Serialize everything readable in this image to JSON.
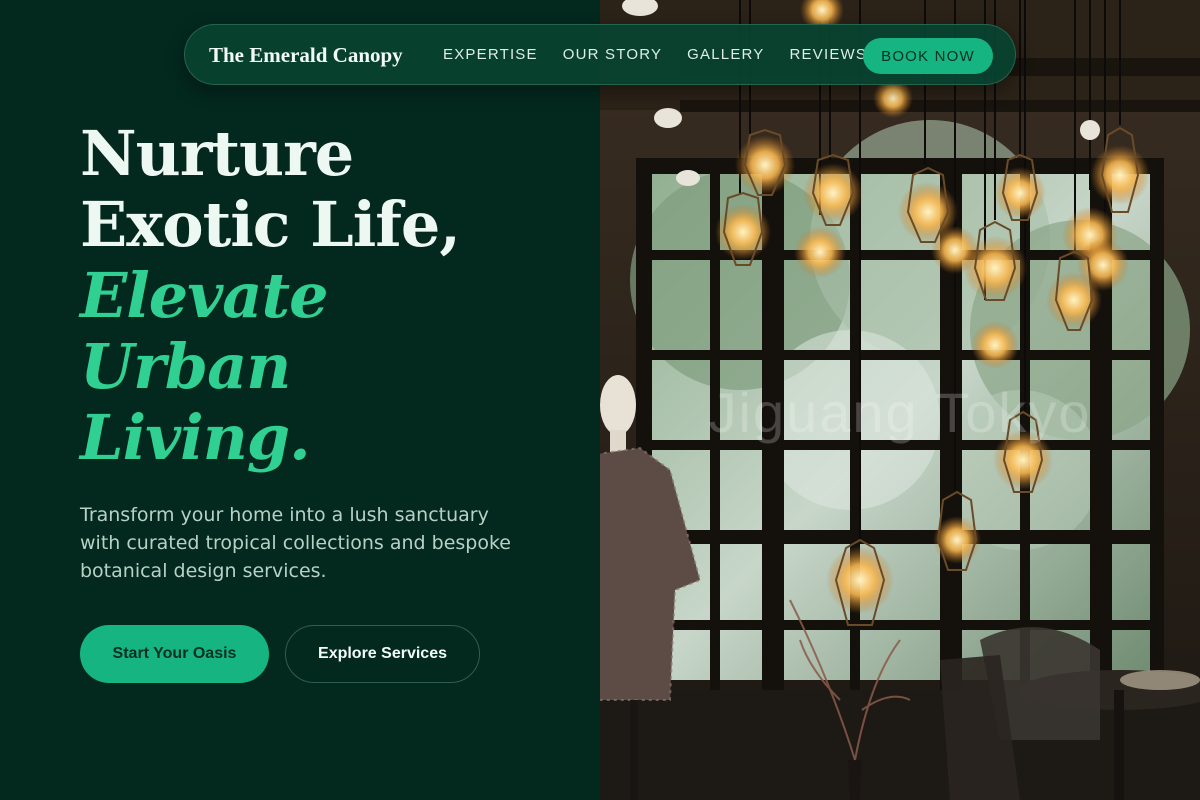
{
  "nav": {
    "brand": "The Emerald Canopy",
    "links": [
      "EXPERTISE",
      "OUR STORY",
      "GALLERY",
      "REVIEWS"
    ],
    "cta": "BOOK NOW"
  },
  "hero": {
    "headline_lines": [
      "Nurture",
      "Exotic Life,"
    ],
    "accent_lines": [
      "Elevate",
      "Urban",
      "Living."
    ],
    "subtitle": "Transform your home into a lush sanctuary with curated tropical collections and bespoke botanical design services.",
    "primary_button": "Start Your Oasis",
    "secondary_button": "Explore Services"
  },
  "photo": {
    "watermark": "Jiguang Tokyo"
  },
  "colors": {
    "background": "#03281e",
    "accent": "#2fd091",
    "button": "#16b480",
    "nav": "#084230"
  }
}
